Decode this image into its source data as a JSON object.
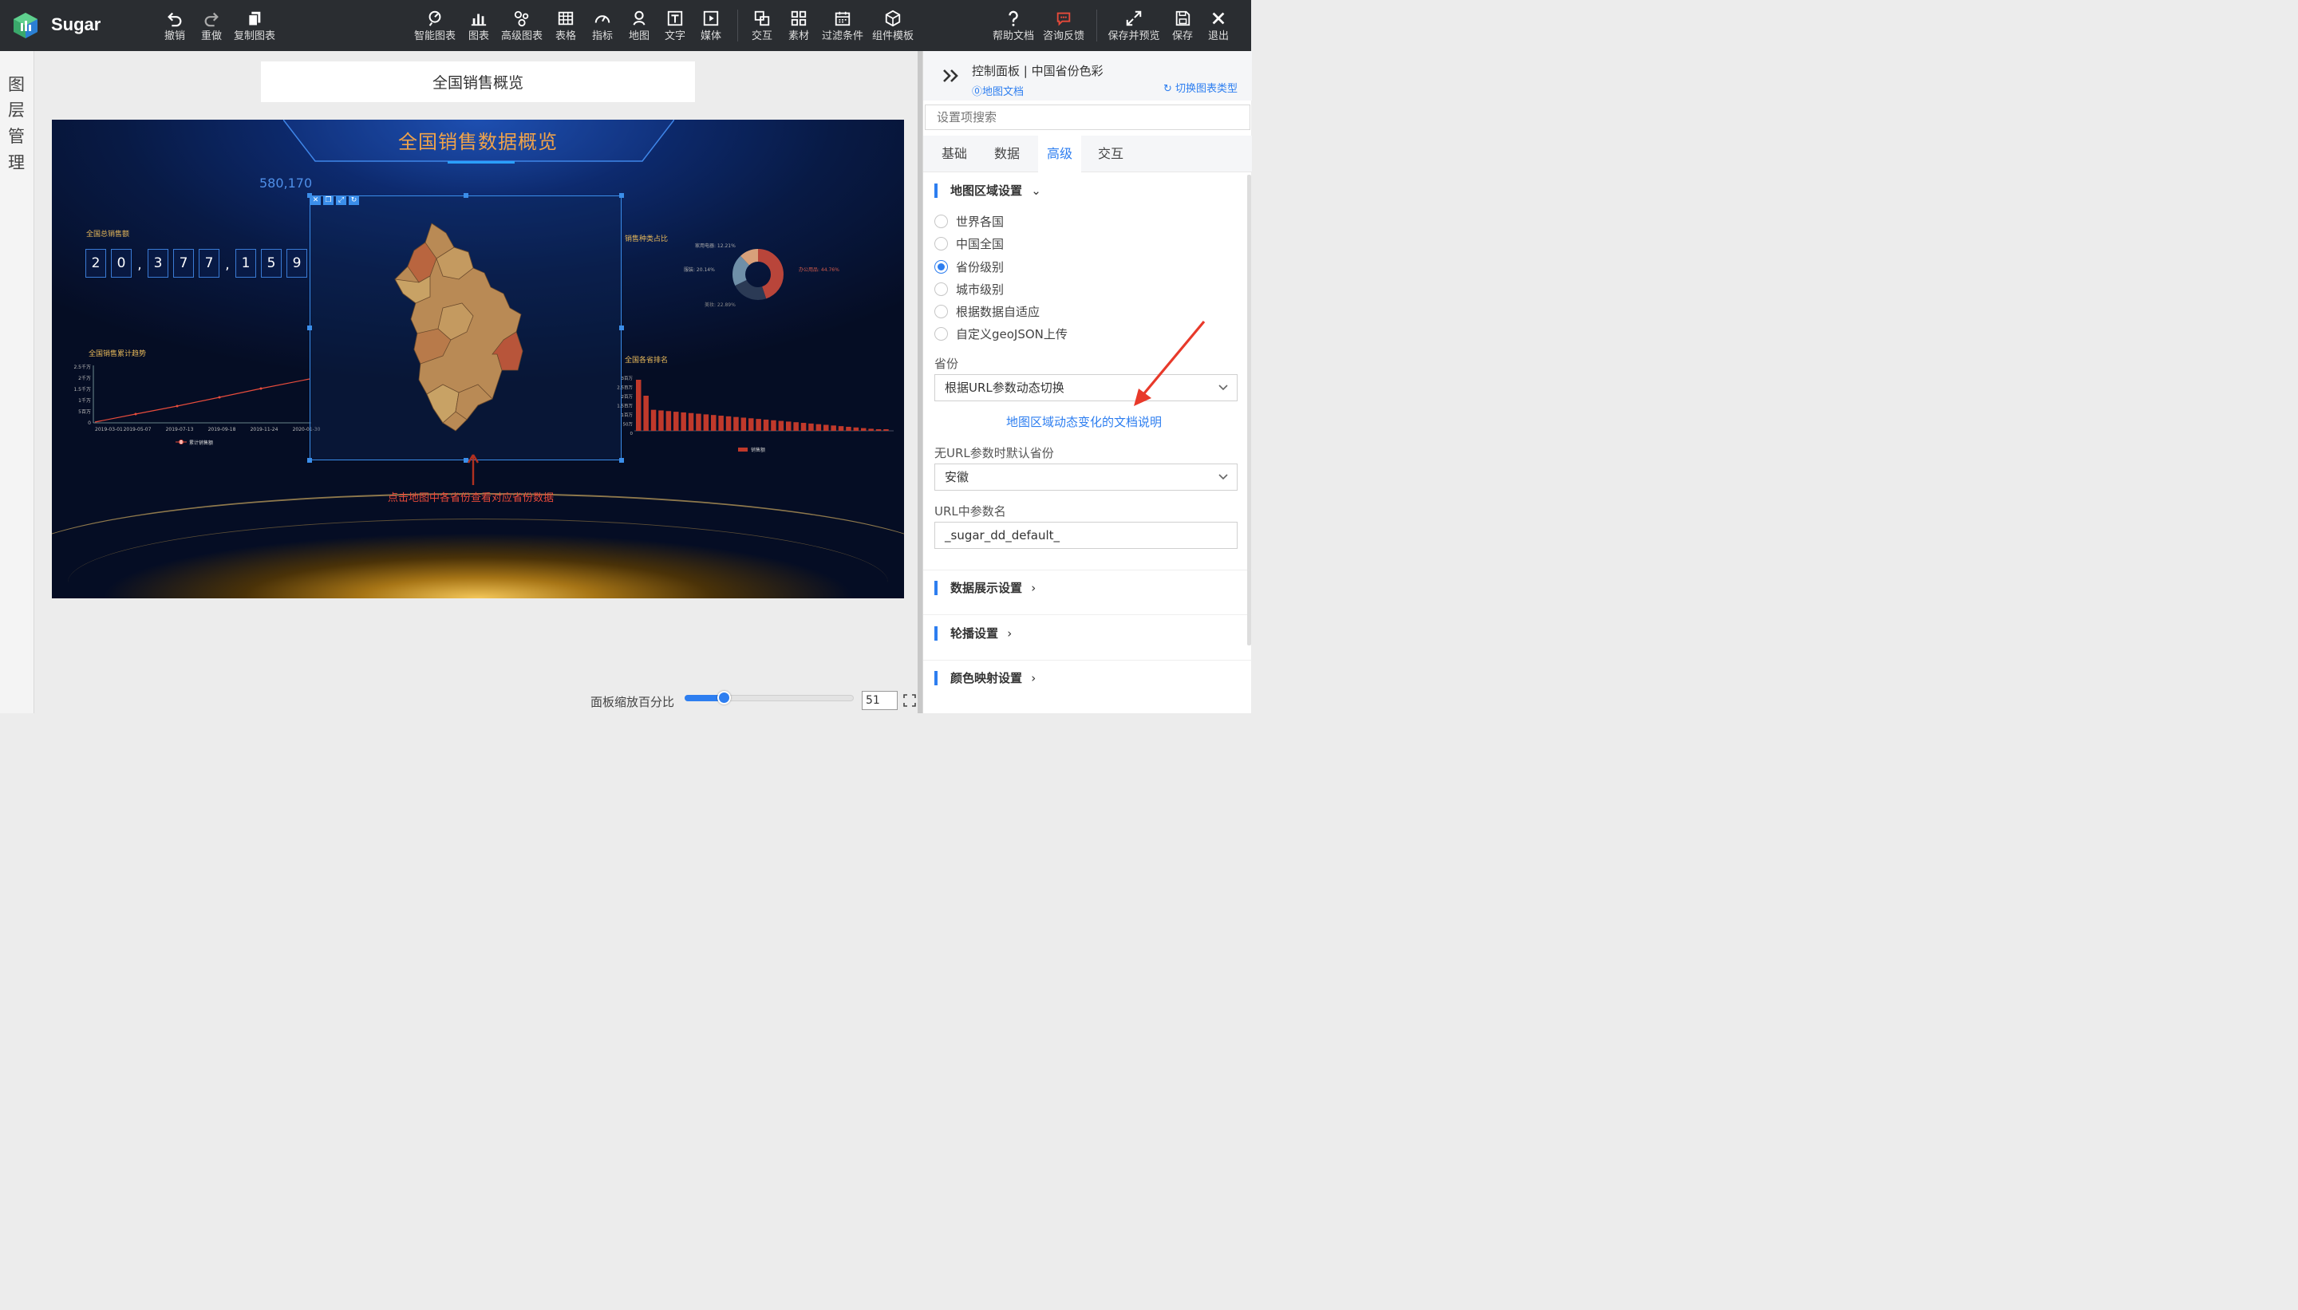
{
  "app": {
    "brand": "Sugar"
  },
  "toolbar": {
    "undo": "撤销",
    "redo": "重做",
    "copy_chart": "复制图表",
    "smart_chart": "智能图表",
    "chart": "图表",
    "advanced_chart": "高级图表",
    "table": "表格",
    "metric": "指标",
    "map": "地图",
    "text": "文字",
    "media": "媒体",
    "interaction": "交互",
    "assets": "素材",
    "filter": "过滤条件",
    "component_template": "组件模板",
    "help_doc": "帮助文档",
    "feedback": "咨询反馈",
    "save_preview": "保存并预览",
    "save": "保存",
    "exit": "退出"
  },
  "left_rail": {
    "chars": [
      "图",
      "层",
      "管",
      "理"
    ]
  },
  "canvas": {
    "title": "全国销售概览",
    "zoom_label": "面板缩放百分比",
    "zoom_value": "51"
  },
  "dashboard": {
    "title": "全国销售数据概览",
    "total_label": "全国总销售额",
    "total_digits": [
      "2",
      "0",
      ",",
      "3",
      "7",
      "7",
      ",",
      "1",
      "5",
      "9"
    ],
    "big_number": "580,170",
    "trend_label": "全国销售累计趋势",
    "trend_y_ticks": [
      "2.5千万",
      "2千万",
      "1.5千万",
      "1千万",
      "5百万",
      "0"
    ],
    "trend_x_ticks": [
      "2019-03-01",
      "2019-05-07",
      "2019-07-13",
      "2019-09-18",
      "2019-11-24",
      "2020-01-30"
    ],
    "trend_legend": "累计销售额",
    "category_label": "销售种类占比",
    "pie_labels": {
      "a": "家用电器: 12.21%",
      "b": "服装: 20.14%",
      "c": "美妆: 22.89%",
      "d": "办公用品: 44.76%"
    },
    "rank_label": "全国各省排名",
    "rank_y_ticks": [
      "3百万",
      "2.5百万",
      "2百万",
      "1.5百万",
      "1百万",
      "50万",
      "0"
    ],
    "rank_legend": "销售额",
    "hint": "点击地图中各省份查看对应省份数据"
  },
  "right_panel": {
    "title": "控制面板 | 中国省份色彩",
    "map_doc": "⓪地图文档",
    "switch_type": "切换图表类型",
    "search_placeholder": "设置项搜索",
    "tabs": [
      "基础",
      "数据",
      "高级",
      "交互"
    ],
    "active_tab": "高级",
    "section_region": "地图区域设置",
    "region_options": [
      "世界各国",
      "中国全国",
      "省份级别",
      "城市级别",
      "根据数据自适应",
      "自定义geoJSON上传"
    ],
    "selected_region": "省份级别",
    "province_label": "省份",
    "province_value": "根据URL参数动态切换",
    "doc_link": "地图区域动态变化的文档说明",
    "default_province_label": "无URL参数时默认省份",
    "default_province_value": "安徽",
    "url_param_label": "URL中参数名",
    "url_param_value": "_sugar_dd_default_",
    "section_data_display": "数据展示设置",
    "section_carousel": "轮播设置",
    "section_color_map": "颜色映射设置"
  },
  "colors": {
    "accent": "#2d7ef0",
    "topbar": "#2a2d31",
    "dash_title": "#f0a34a",
    "bar": "#c0392b",
    "hint": "#e84a3a"
  }
}
